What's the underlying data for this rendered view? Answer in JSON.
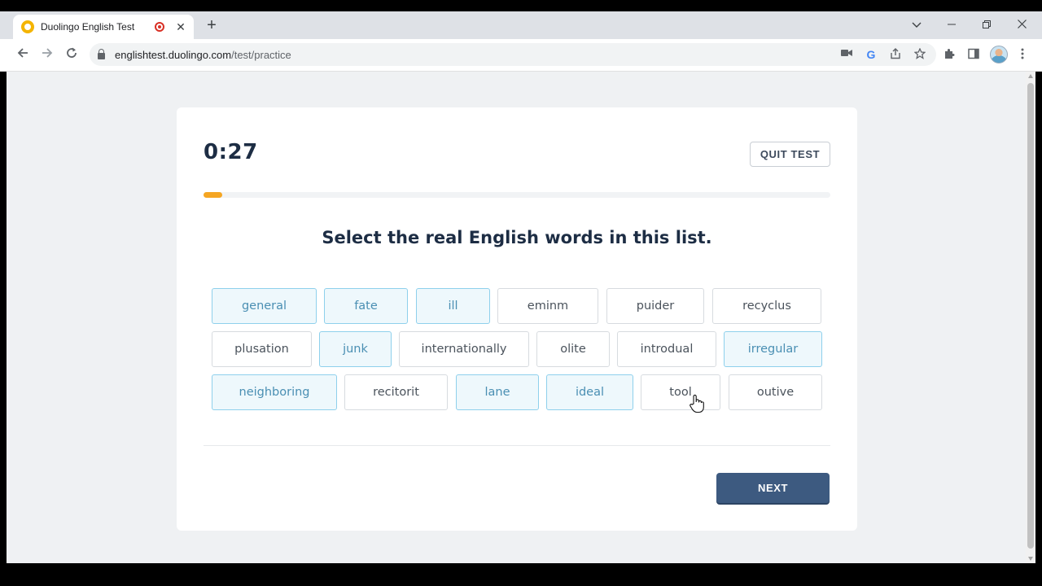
{
  "browser": {
    "tab_title": "Duolingo English Test",
    "tab_close": "✕",
    "new_tab": "+",
    "url_host": "englishtest.duolingo.com",
    "url_path": "/test/practice",
    "window_controls": [
      "chevron-down",
      "minimize",
      "restore",
      "close"
    ]
  },
  "test": {
    "timer": "0:27",
    "quit_label": "QUIT TEST",
    "progress_percent": 3,
    "prompt": "Select the real English words in this list.",
    "next_label": "NEXT",
    "accent_color": "#f5a623",
    "button_color": "#3d5a80",
    "words": [
      {
        "text": "general",
        "selected": true
      },
      {
        "text": "fate",
        "selected": true
      },
      {
        "text": "ill",
        "selected": true
      },
      {
        "text": "eminm",
        "selected": false
      },
      {
        "text": "puider",
        "selected": false
      },
      {
        "text": "recyclus",
        "selected": false
      },
      {
        "text": "plusation",
        "selected": false
      },
      {
        "text": "junk",
        "selected": true
      },
      {
        "text": "internationally",
        "selected": false
      },
      {
        "text": "olite",
        "selected": false
      },
      {
        "text": "introdual",
        "selected": false
      },
      {
        "text": "irregular",
        "selected": true
      },
      {
        "text": "neighboring",
        "selected": true
      },
      {
        "text": "recitorit",
        "selected": false
      },
      {
        "text": "lane",
        "selected": true
      },
      {
        "text": "ideal",
        "selected": true
      },
      {
        "text": "tool",
        "selected": false
      },
      {
        "text": "outive",
        "selected": false
      }
    ]
  }
}
